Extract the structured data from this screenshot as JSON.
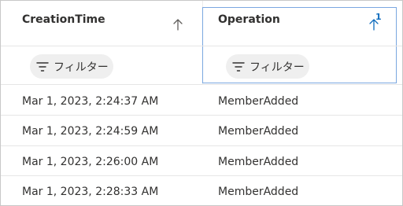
{
  "columns": [
    {
      "header": "CreationTime",
      "sort_icon": "arrow-up-icon",
      "filter_label": "フィルター"
    },
    {
      "header": "Operation",
      "sort_icon": "arrow-up-icon",
      "sort_badge": "1",
      "filter_label": "フィルター"
    }
  ],
  "rows": [
    {
      "creation_time": "Mar 1, 2023, 2:24:37 AM",
      "operation": "MemberAdded"
    },
    {
      "creation_time": "Mar 1, 2023, 2:24:59 AM",
      "operation": "MemberAdded"
    },
    {
      "creation_time": "Mar 1, 2023, 2:26:00 AM",
      "operation": "MemberAdded"
    },
    {
      "creation_time": "Mar 1, 2023, 2:28:33 AM",
      "operation": "MemberAdded"
    }
  ],
  "colors": {
    "accent": "#0f6cbd",
    "text": "#323130",
    "pill_background": "#efefef",
    "focus_border": "#7aa7e0",
    "row_divider": "#e6e6e6"
  }
}
